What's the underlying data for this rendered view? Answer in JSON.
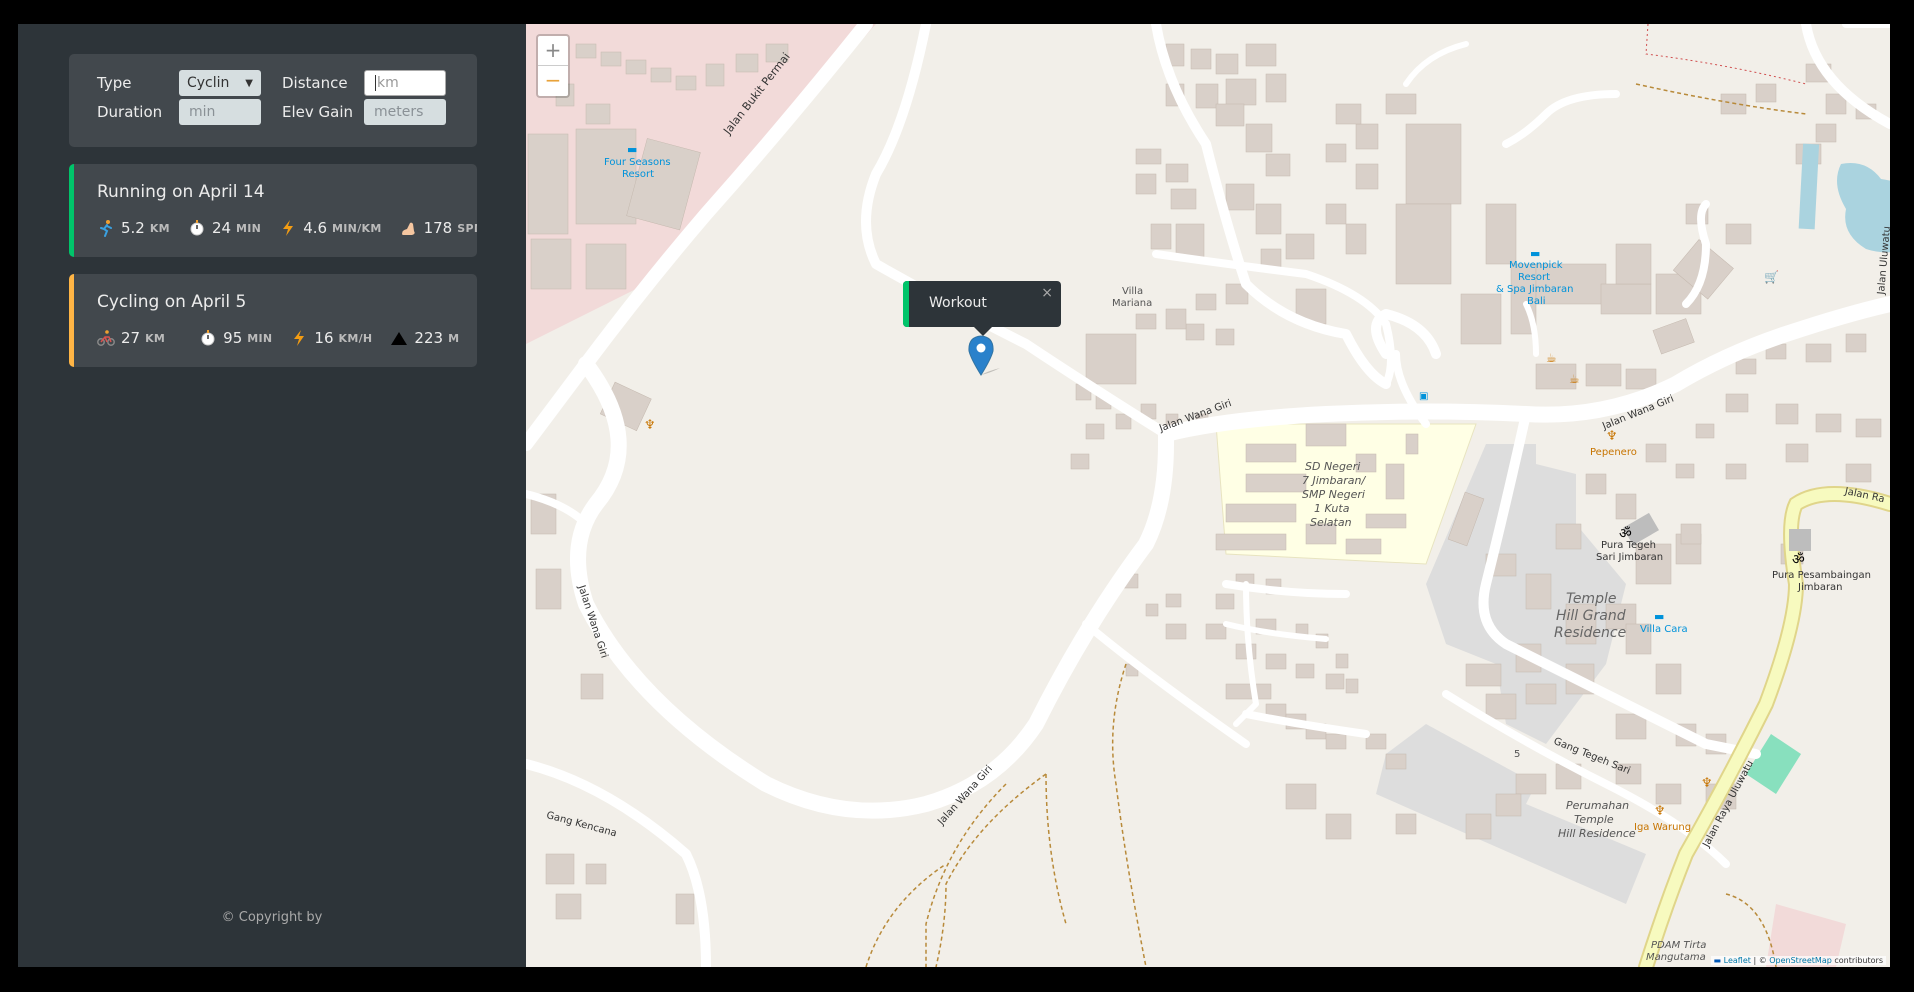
{
  "form": {
    "type_label": "Type",
    "type_value": "Cyclin",
    "distance_label": "Distance",
    "distance_placeholder": "km",
    "duration_label": "Duration",
    "duration_placeholder": "min",
    "elev_label": "Elev Gain",
    "elev_placeholder": "meters"
  },
  "workouts": [
    {
      "title": "Running on April 14",
      "color": "#00c46a",
      "stats": [
        {
          "icon": "runner-icon",
          "value": "5.2",
          "unit": "KM"
        },
        {
          "icon": "stopwatch-icon",
          "value": "24",
          "unit": "MIN"
        },
        {
          "icon": "lightning-icon",
          "value": "4.6",
          "unit": "MIN/KM"
        },
        {
          "icon": "footprint-icon",
          "value": "178",
          "unit": "SPM"
        }
      ]
    },
    {
      "title": "Cycling on April 5",
      "color": "#ffb545",
      "stats": [
        {
          "icon": "cyclist-icon",
          "value": "27",
          "unit": "KM"
        },
        {
          "icon": "stopwatch-icon",
          "value": "95",
          "unit": "MIN"
        },
        {
          "icon": "lightning-icon",
          "value": "16",
          "unit": "KM/H"
        },
        {
          "icon": "mountain-icon",
          "value": "223",
          "unit": "M"
        }
      ]
    }
  ],
  "copyright": "© Copyright by",
  "map": {
    "zoom_in": "+",
    "zoom_out": "−",
    "popup_text": "Workout",
    "popup_close": "×",
    "attribution_leaflet": "Leaflet",
    "attribution_sep": " | © ",
    "attribution_osm": "OpenStreetMap",
    "attribution_tail": " contributors",
    "labels": {
      "jalan_bukit_permai": "Jalan Bukit Permai",
      "four_seasons": "Four Seasons",
      "resort": "Resort",
      "villa": "Villa",
      "mariana": "Mariana",
      "jalan_wana_giri_1": "Jalan Wana Giri",
      "jalan_wana_giri_2": "Jalan Wana Giri",
      "jalan_wana_giri_3": "Jalan Wana Giri",
      "jalan_wana_giri_4": "Jalan Wana Giri",
      "movenpick_1": "Movenpick",
      "movenpick_2": "Resort",
      "movenpick_3": "& Spa Jimbaran",
      "movenpick_4": "Bali",
      "pepenero": "Pepenero",
      "sd_1": "SD Negeri",
      "sd_2": "7 Jimbaran/",
      "sd_3": "SMP Negeri",
      "sd_4": "1 Kuta",
      "sd_5": "Selatan",
      "pura_tegeh_1": "Pura Tegeh",
      "pura_tegeh_2": "Sari Jimbaran",
      "temple_1": "Temple",
      "temple_2": "Hill Grand",
      "temple_3": "Residence",
      "villa_cara": "Villa Cara",
      "pura_pes_1": "Pura Pesambaingan",
      "pura_pes_2": "Jimbaran",
      "jalan_ra": "Jalan Ra",
      "gang_tegeh_sari": "Gang Tegeh Sari",
      "perumahan_1": "Perumahan",
      "perumahan_2": "Temple",
      "perumahan_3": "Hill Residence",
      "iga_warung": "Iga Warung",
      "jalan_raya_uluwatu": "Jalan Raya Uluwatu",
      "gang_kencana": "Gang Kencana",
      "pdam_1": "PDAM Tirta",
      "pdam_2": "Mangutama",
      "jalan_uluwatu_edge": "Jalan Uluwatu",
      "house_5": "5"
    }
  }
}
